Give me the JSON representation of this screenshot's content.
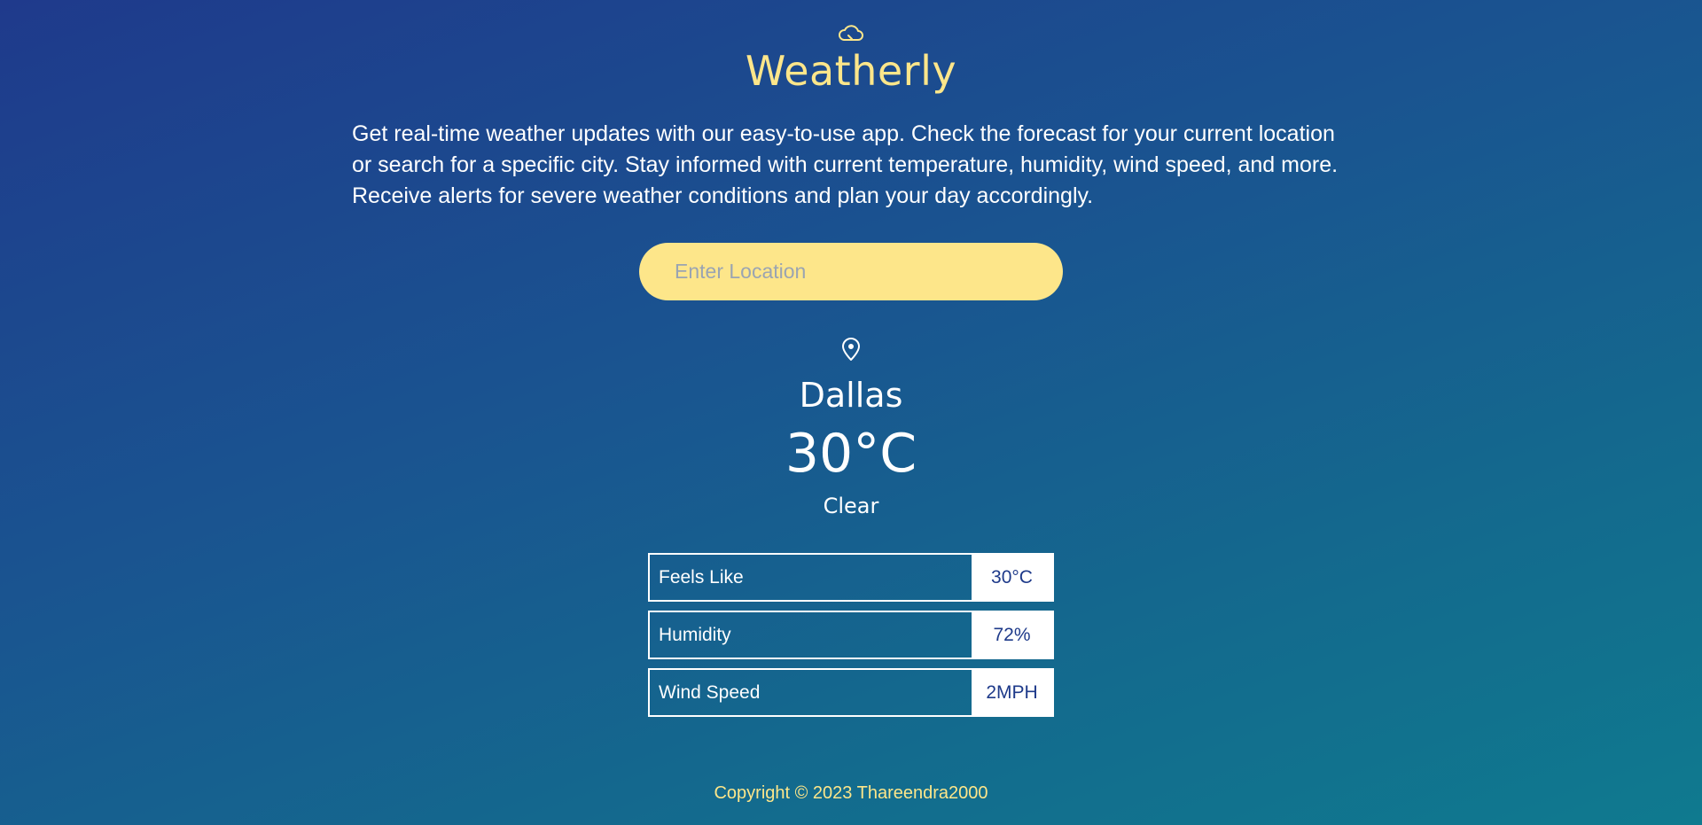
{
  "app": {
    "title": "Weatherly",
    "logo_icon": "cloud-icon",
    "description": "Get real-time weather updates with our easy-to-use app. Check the forecast for your current location or search for a specific city. Stay informed with current temperature, humidity, wind speed, and more. Receive alerts for severe weather conditions and plan your day accordingly."
  },
  "search": {
    "placeholder": "Enter Location",
    "value": ""
  },
  "weather": {
    "location_icon": "map-pin-icon",
    "city": "Dallas",
    "temperature": "30°C",
    "condition": "Clear"
  },
  "stats": [
    {
      "label": "Feels Like",
      "value": "30°C"
    },
    {
      "label": "Humidity",
      "value": "72%"
    },
    {
      "label": "Wind Speed",
      "value": "2MPH"
    }
  ],
  "footer": {
    "copyright": "Copyright © 2023 Thareendra2000"
  },
  "colors": {
    "accent": "#fde68a",
    "background_start": "#1f3a8c",
    "background_end": "#0f7a8f",
    "value_text": "#1e3a8a"
  }
}
